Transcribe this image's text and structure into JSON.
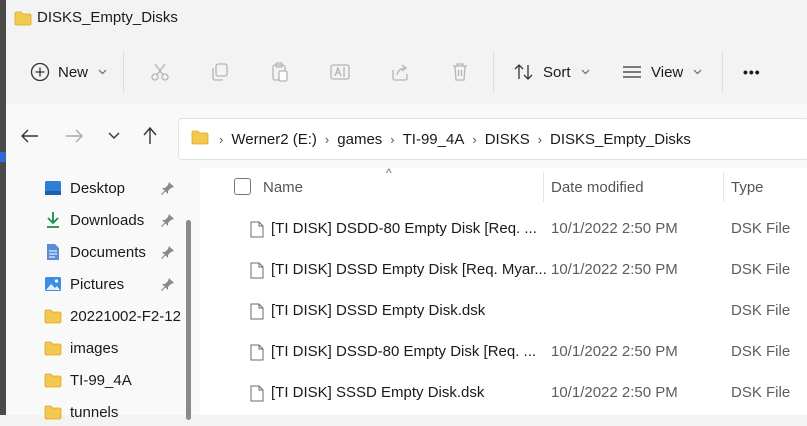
{
  "window": {
    "title": "DISKS_Empty_Disks"
  },
  "toolbar": {
    "new_label": "New",
    "sort_label": "Sort",
    "view_label": "View",
    "more_label": "•••"
  },
  "address": {
    "crumbs": [
      "Werner2 (E:)",
      "games",
      "TI-99_4A",
      "DISKS",
      "DISKS_Empty_Disks"
    ]
  },
  "sidebar": {
    "items": [
      {
        "label": "Desktop",
        "icon": "desktop-icon",
        "pinned": true
      },
      {
        "label": "Downloads",
        "icon": "download-icon",
        "pinned": true
      },
      {
        "label": "Documents",
        "icon": "documents-icon",
        "pinned": true
      },
      {
        "label": "Pictures",
        "icon": "pictures-icon",
        "pinned": true
      },
      {
        "label": "20221002-F2-12",
        "icon": "folder-icon",
        "pinned": false
      },
      {
        "label": "images",
        "icon": "folder-icon",
        "pinned": false
      },
      {
        "label": "TI-99_4A",
        "icon": "folder-icon",
        "pinned": false
      },
      {
        "label": "tunnels",
        "icon": "folder-icon",
        "pinned": false
      }
    ]
  },
  "columns": {
    "name": "Name",
    "date": "Date modified",
    "type": "Type"
  },
  "files": [
    {
      "name": "[TI DISK] DSDD-80 Empty Disk [Req. ...",
      "date": "10/1/2022 2:50 PM",
      "type": "DSK File"
    },
    {
      "name": "[TI DISK] DSSD Empty Disk [Req. Myar...",
      "date": "10/1/2022 2:50 PM",
      "type": "DSK File"
    },
    {
      "name": "[TI DISK] DSSD Empty Disk.dsk",
      "date": "",
      "type": "DSK File"
    },
    {
      "name": "[TI DISK] DSSD-80 Empty Disk [Req. ...",
      "date": "10/1/2022 2:50 PM",
      "type": "DSK File"
    },
    {
      "name": "[TI DISK] SSSD Empty Disk.dsk",
      "date": "10/1/2022 2:50 PM",
      "type": "DSK File"
    }
  ],
  "colors": {
    "folder": "#f2c94c",
    "accent": "#2b6cd4"
  }
}
